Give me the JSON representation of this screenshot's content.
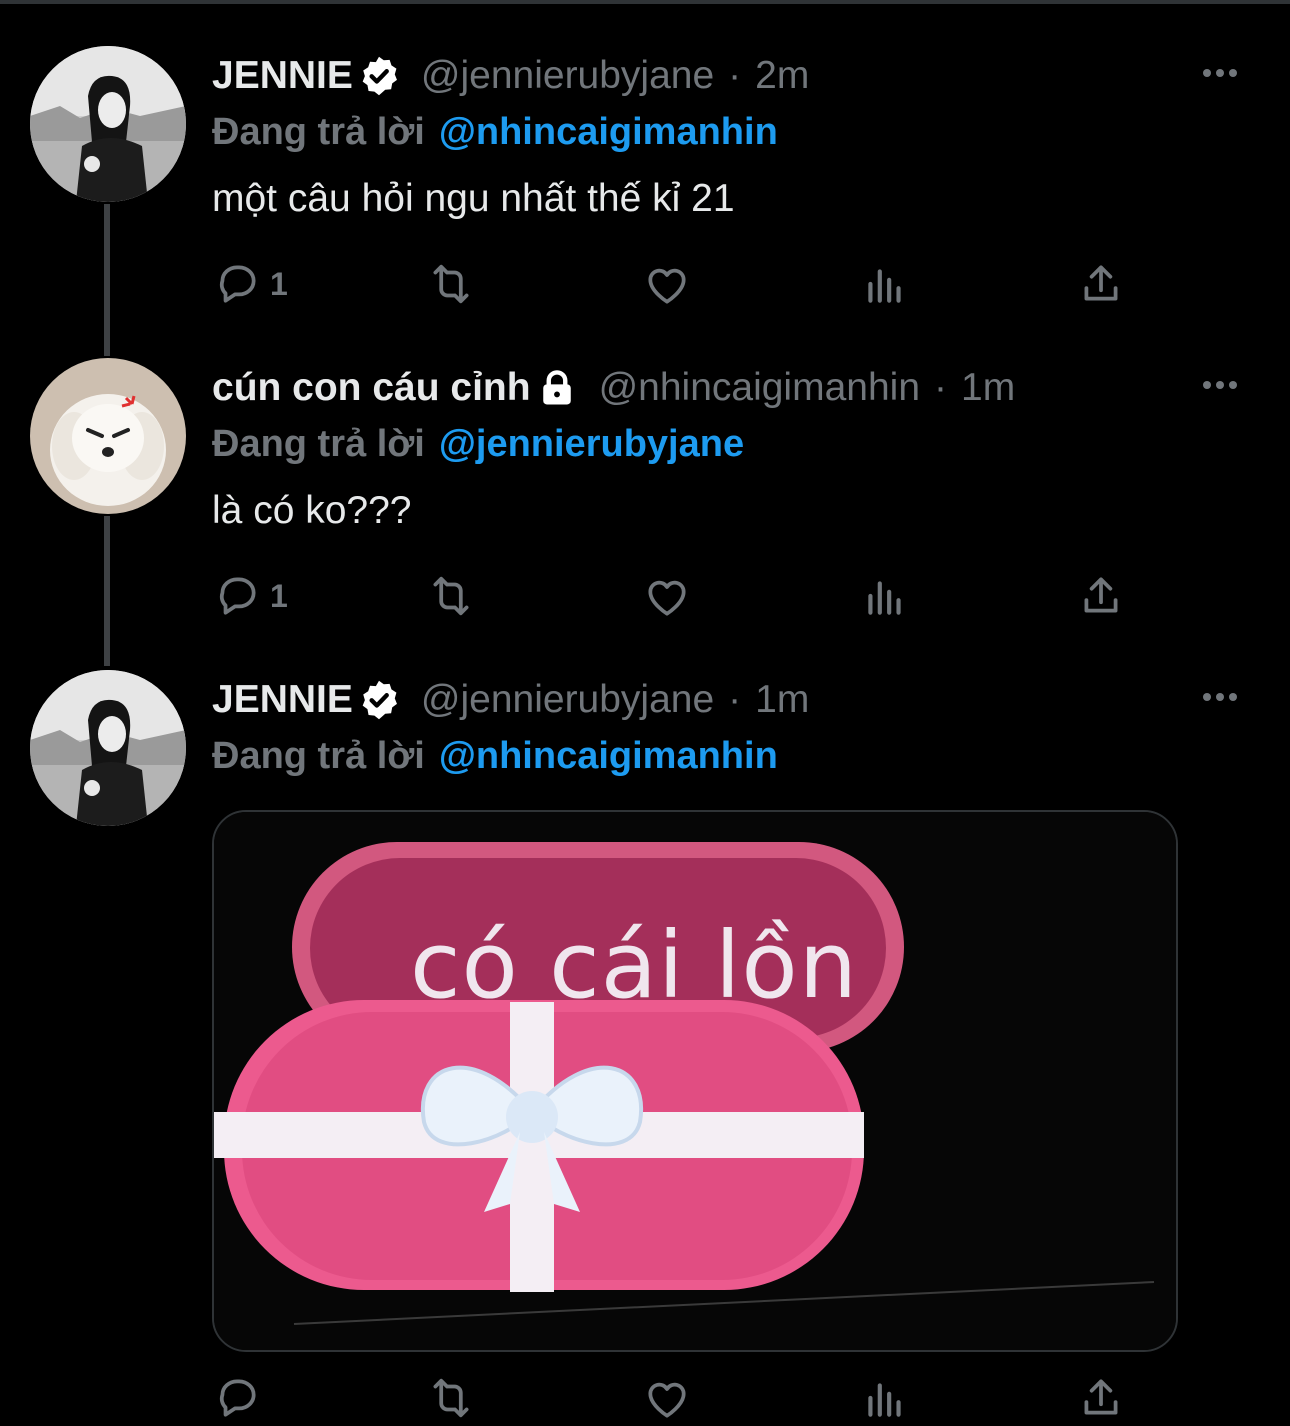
{
  "colors": {
    "background": "#000000",
    "text_primary": "#e7e9ea",
    "text_secondary": "#71767b",
    "accent": "#1d9bf0",
    "thread_line": "#3e4144"
  },
  "tweets": [
    {
      "name": "JENNIE",
      "badge": "verified-badge-icon",
      "handle": "@jennierubyjane",
      "separator": "·",
      "time": "2m",
      "reply_prefix": "Đang trả lời",
      "reply_to": "@nhincaigimanhin",
      "text": "một câu hỏi ngu nhất thế kỉ 21",
      "reply_count": "1"
    },
    {
      "name": "cún con cáu cỉnh",
      "badge": "lock-icon",
      "handle": "@nhincaigimanhin",
      "separator": "·",
      "time": "1m",
      "reply_prefix": "Đang trả lời",
      "reply_to": "@jennierubyjane",
      "text": "là có ko???",
      "reply_count": "1"
    },
    {
      "name": "JENNIE",
      "badge": "verified-badge-icon",
      "handle": "@jennierubyjane",
      "separator": "·",
      "time": "1m",
      "reply_prefix": "Đang trả lời",
      "reply_to": "@nhincaigimanhin",
      "media_caption": "có cái lồn",
      "reply_count": ""
    }
  ]
}
